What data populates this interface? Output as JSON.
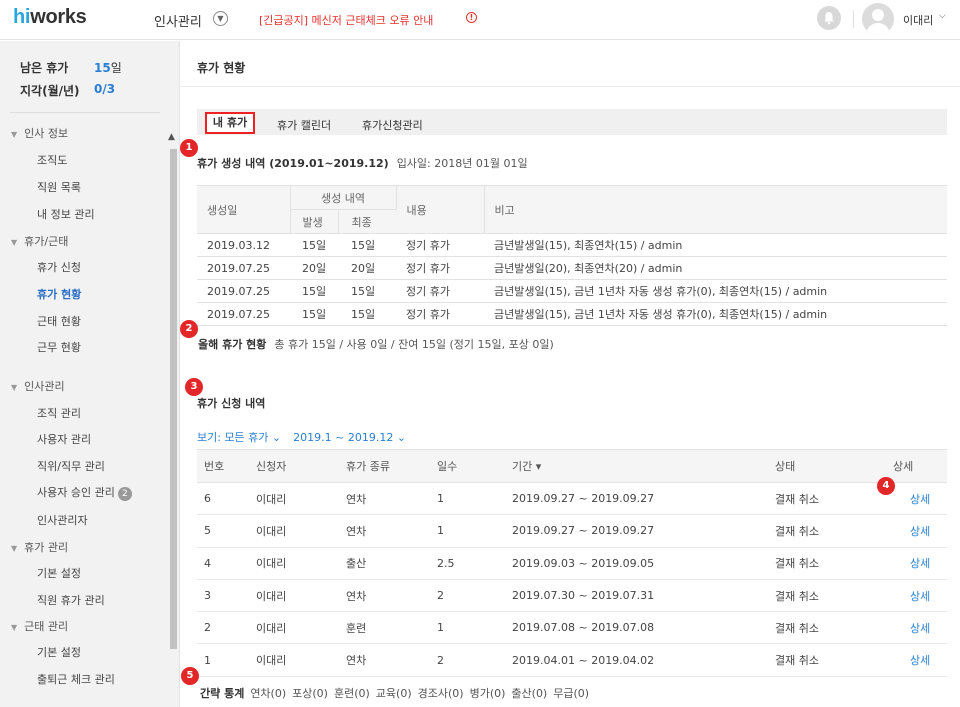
{
  "header": {
    "logo_hi": "hi",
    "logo_rest": "works",
    "app_title": "인사관리",
    "notice": "[긴급공지] 메신저 근태체크 오류 안내",
    "notice_icon": "!",
    "username": "이대리",
    "icons": [
      "chevron-down-icon",
      "bell-icon",
      "avatar-icon"
    ]
  },
  "sidebar": {
    "summary": [
      {
        "label": "남은 휴가",
        "value": "15",
        "unit": "일"
      },
      {
        "label": "지각(월/년)",
        "value": "0/3",
        "unit": ""
      }
    ],
    "sections": [
      {
        "title": "인사 정보",
        "items": [
          "조직도",
          "직원 목록",
          "내 정보 관리"
        ]
      },
      {
        "title": "휴가/근태",
        "items": [
          "휴가 신청",
          "휴가 현황",
          "근태 현황",
          "근무 현황"
        ]
      },
      {
        "title": "인사관리",
        "items": [
          "조직 관리",
          "사용자 관리",
          "직위/직무 관리",
          "사용자 승인 관리",
          "인사관리자"
        ]
      },
      {
        "title": "휴가 관리",
        "items": [
          "기본 설정",
          "직원 휴가 관리"
        ]
      },
      {
        "title": "근태 관리",
        "items": [
          "기본 설정",
          "출퇴근 체크 관리"
        ]
      }
    ],
    "active_item": "휴가 현황",
    "approval_badge": "2"
  },
  "main": {
    "page_title": "휴가 현황",
    "tabs": [
      "내 휴가",
      "휴가 캘린더",
      "휴가신청관리"
    ],
    "markers": [
      "1",
      "2",
      "3",
      "4",
      "5"
    ],
    "generation": {
      "title": "휴가 생성 내역 (2019.01~2019.12)",
      "subtitle": "입사일: 2018년 01월 01일",
      "headers": {
        "date": "생성일",
        "group": "생성 내역",
        "occur": "발생",
        "final": "최종",
        "content": "내용",
        "note": "비고"
      },
      "rows": [
        {
          "date": "2019.03.12",
          "occur": "15일",
          "final": "15일",
          "content": "정기 휴가",
          "note": "금년발생일(15), 최종연차(15) / admin"
        },
        {
          "date": "2019.07.25",
          "occur": "20일",
          "final": "20일",
          "content": "정기 휴가",
          "note": "금년발생일(20), 최종연차(20) / admin"
        },
        {
          "date": "2019.07.25",
          "occur": "15일",
          "final": "15일",
          "content": "정기 휴가",
          "note": "금년발생일(15), 금년 1년차 자동 생성 휴가(0), 최종연차(15) / admin"
        },
        {
          "date": "2019.07.25",
          "occur": "15일",
          "final": "15일",
          "content": "정기 휴가",
          "note": "금년발생일(15), 금년 1년차 자동 생성 휴가(0), 최종연차(15) / admin"
        }
      ]
    },
    "status": {
      "label": "올해 휴가 현황",
      "text": "총 휴가 15일 / 사용 0일 / 잔여 15일 (정기 15일, 포상 0일)"
    },
    "requests": {
      "title": "휴가 신청 내역",
      "filter_type": "보기: 모든 휴가 ⌄",
      "filter_period": "2019.1 ~ 2019.12 ⌄",
      "headers": [
        "번호",
        "신청자",
        "휴가 종류",
        "일수",
        "기간 ▾",
        "상태",
        "상세"
      ],
      "rows": [
        {
          "no": "6",
          "applicant": "이대리",
          "type": "연차",
          "days": "1",
          "period": "2019.09.27 ~ 2019.09.27",
          "status": "결재 취소",
          "detail": "상세"
        },
        {
          "no": "5",
          "applicant": "이대리",
          "type": "연차",
          "days": "1",
          "period": "2019.09.27 ~ 2019.09.27",
          "status": "결재 취소",
          "detail": "상세"
        },
        {
          "no": "4",
          "applicant": "이대리",
          "type": "출산",
          "days": "2.5",
          "period": "2019.09.03 ~ 2019.09.05",
          "status": "결재 취소",
          "detail": "상세"
        },
        {
          "no": "3",
          "applicant": "이대리",
          "type": "연차",
          "days": "2",
          "period": "2019.07.30 ~ 2019.07.31",
          "status": "결재 취소",
          "detail": "상세"
        },
        {
          "no": "2",
          "applicant": "이대리",
          "type": "훈련",
          "days": "1",
          "period": "2019.07.08 ~ 2019.07.08",
          "status": "결재 취소",
          "detail": "상세"
        },
        {
          "no": "1",
          "applicant": "이대리",
          "type": "연차",
          "days": "2",
          "period": "2019.04.01 ~ 2019.04.02",
          "status": "결재 취소",
          "detail": "상세"
        }
      ]
    },
    "stats": {
      "label": "간략 통계",
      "items": [
        "연차(0)",
        "포상(0)",
        "훈련(0)",
        "교육(0)",
        "경조사(0)",
        "병가(0)",
        "출산(0)",
        "무급(0)"
      ]
    }
  },
  "colors": {
    "accent": "#2a7fd4",
    "marker": "#e32628",
    "notice": "#e8312f",
    "logo_hi": "#2aa7e0"
  }
}
